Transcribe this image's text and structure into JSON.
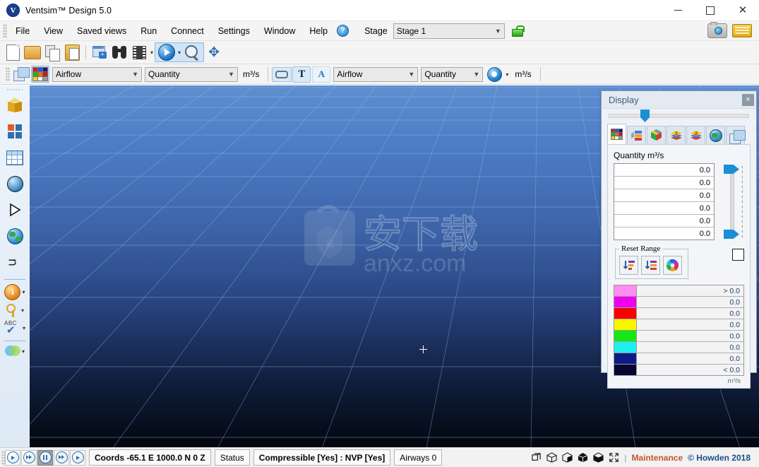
{
  "window": {
    "title": "Ventsim™ Design 5.0",
    "logo": "V",
    "controls": {
      "minimize": "minimize-icon",
      "maximize": "maximize-icon",
      "close": "close-icon"
    }
  },
  "menubar": {
    "items": [
      "File",
      "View",
      "Saved views",
      "Run",
      "Connect",
      "Settings",
      "Window",
      "Help"
    ],
    "help_badge": "?",
    "stage_label": "Stage",
    "stage_value": "Stage 1",
    "lock_icon": "unlocked-padlock-icon",
    "right_icons": [
      "camera-icon",
      "license-card-icon"
    ]
  },
  "toolbar1": {
    "buttons": [
      {
        "name": "new-file-button",
        "icon": "new-document-icon"
      },
      {
        "name": "open-file-button",
        "icon": "open-folder-icon"
      },
      {
        "name": "copy-button",
        "icon": "copy-pages-icon"
      },
      {
        "name": "paste-button",
        "icon": "clipboard-paste-icon"
      },
      {
        "name": "new-window-button",
        "icon": "new-window-icon"
      },
      {
        "name": "find-button",
        "icon": "binoculars-icon"
      },
      {
        "name": "animation-button",
        "icon": "film-strip-icon"
      },
      {
        "name": "run-simulation-button",
        "icon": "play-circle-icon"
      },
      {
        "name": "zoom-button",
        "icon": "magnifier-icon"
      },
      {
        "name": "pan-button",
        "icon": "move-arrows-icon"
      }
    ],
    "dropdown_caret": "▾"
  },
  "toolbar2": {
    "layers_icon": "layers-overlay-icon",
    "palette_icon": "color-palette-icon",
    "color_by": "Airflow",
    "color_value": "Quantity",
    "color_unit": "m³/s",
    "link_icon": "link-icon",
    "text_icon": "T",
    "font_icon": "A",
    "label_by": "Airflow",
    "label_value": "Quantity",
    "label_unit": "m³/s",
    "sphere_icon": "blue-sphere-icon",
    "caret": "▾"
  },
  "rail": {
    "items": [
      {
        "name": "sidebar-item-model",
        "icon": "gold-cube-icon"
      },
      {
        "name": "sidebar-item-transform",
        "icon": "four-arrows-icon"
      },
      {
        "name": "sidebar-item-table",
        "icon": "spreadsheet-grid-icon"
      },
      {
        "name": "sidebar-item-sphere",
        "icon": "blue-sphere-icon"
      },
      {
        "name": "sidebar-item-play",
        "icon": "play-triangle-icon"
      },
      {
        "name": "sidebar-item-globe",
        "icon": "globe-icon"
      },
      {
        "name": "sidebar-item-flow",
        "icon": "flow-wave-icon"
      },
      {
        "name": "sidebar-item-info",
        "icon": "orange-info-icon",
        "caret": "▾"
      },
      {
        "name": "sidebar-item-key",
        "icon": "gold-key-icon",
        "caret": "▾"
      },
      {
        "name": "sidebar-item-abc-check",
        "icon": "abc-check-icon",
        "label": "ABC",
        "caret": "▾"
      },
      {
        "name": "sidebar-item-venn",
        "icon": "venn-circles-icon",
        "caret": "▾"
      }
    ]
  },
  "viewport": {
    "watermark_text": "anxz.com",
    "watermark_cjk": "安下载",
    "crosshair": "crosshair-cursor"
  },
  "panel": {
    "title": "Display",
    "close_label": "×",
    "tabs": [
      {
        "name": "tab-color-grid",
        "icon": "color-grid-icon",
        "active": true
      },
      {
        "name": "tab-bars",
        "icon": "bar-blocks-icon",
        "active": false
      },
      {
        "name": "tab-cube",
        "icon": "rgb-cube-icon",
        "active": false
      },
      {
        "name": "tab-layer-1",
        "icon": "layer-1-icon",
        "active": false
      },
      {
        "name": "tab-layer-2",
        "icon": "layer-2-icon",
        "active": false
      },
      {
        "name": "tab-globe",
        "icon": "globe-icon",
        "active": false
      },
      {
        "name": "tab-overlay",
        "icon": "overlay-windows-icon",
        "active": false
      }
    ],
    "quantity_label": "Quantity m³/s",
    "range_values": [
      "0.0",
      "0.0",
      "0.0",
      "0.0",
      "0.0",
      "0.0"
    ],
    "reset_range_label": "Reset Range",
    "reset_buttons": [
      {
        "name": "reset-range-down-button",
        "icon": "sort-down-icon"
      },
      {
        "name": "reset-range-filter-button",
        "icon": "sort-filter-icon"
      },
      {
        "name": "color-wheel-button",
        "icon": "color-wheel-icon"
      }
    ],
    "checkbox": {
      "name": "auto-range-checkbox",
      "checked": false
    },
    "legend": {
      "unit": "m³/s",
      "rows": [
        {
          "color": "#ff8cf0",
          "value": "> 0.0"
        },
        {
          "color": "#ef00ef",
          "value": "0.0"
        },
        {
          "color": "#fb0000",
          "value": "0.0"
        },
        {
          "color": "#fbf500",
          "value": "0.0"
        },
        {
          "color": "#14e814",
          "value": "0.0"
        },
        {
          "color": "#1ef0f0",
          "value": "0.0"
        },
        {
          "color": "#101a86",
          "value": "0.0"
        },
        {
          "color": "#060633",
          "value": "< 0.0"
        }
      ]
    }
  },
  "statusbar": {
    "playback": [
      {
        "name": "step-back-button",
        "icon": "play-back-icon",
        "pressed": false
      },
      {
        "name": "rewind-button",
        "icon": "fast-rewind-icon",
        "pressed": false
      },
      {
        "name": "pause-button",
        "icon": "pause-icon",
        "pressed": true
      },
      {
        "name": "forward-button",
        "icon": "fast-forward-icon",
        "pressed": false
      },
      {
        "name": "step-forward-button",
        "icon": "play-forward-icon",
        "pressed": false
      }
    ],
    "coords": "Coords -65.1 E    1000.0 N   0 Z",
    "status_label": "Status",
    "status_value": "Compressible [Yes] : NVP [Yes]",
    "airways": "Airways 0",
    "view_icons": [
      "view-iso-open-icon",
      "view-cube-wire-icon",
      "view-cube-half-icon",
      "view-cube-solid-icon",
      "view-cube-shaded-icon",
      "view-fullscreen-icon"
    ],
    "separator": "|",
    "maintenance": "Maintenance",
    "copyright": "© Howden 2018"
  },
  "colors": {
    "accent": "#1a8ed6",
    "panel_border": "#7f9db9",
    "maintenance": "#c0562a",
    "copyright": "#1a4f8a"
  }
}
